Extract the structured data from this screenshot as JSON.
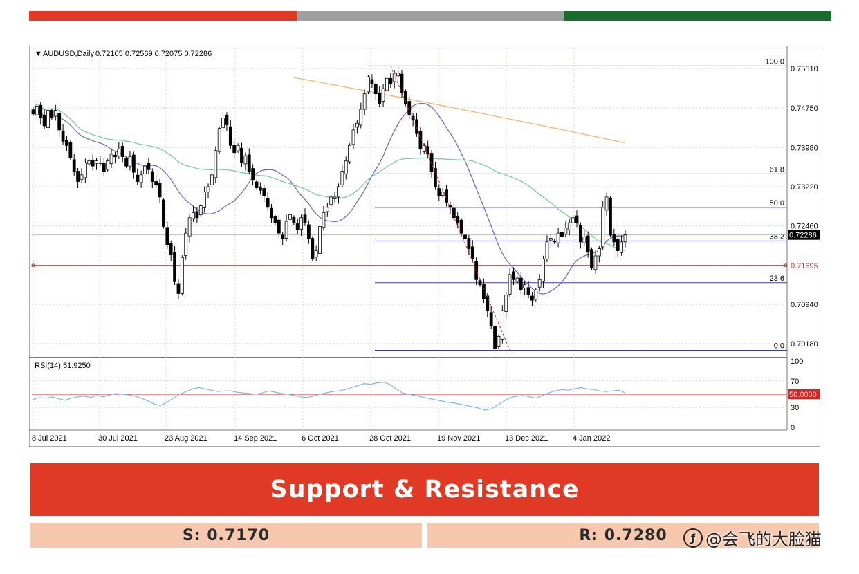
{
  "colors": {
    "red": "#e03a26",
    "gray": "#a0a0a0",
    "green": "#1a6b2e",
    "salmon": "#f6c9ae",
    "grid": "#d4d4d4",
    "bull": "#ffffff",
    "bear": "#000000"
  },
  "chart_header": {
    "symbol": "AUDUSD,Daily",
    "ohlc": "0.72105 0.72569 0.72075 0.72286"
  },
  "rsi_header": {
    "label": "RSI(14) 51.9250"
  },
  "price_axis": {
    "ticks": [
      "0.75510",
      "0.74750",
      "0.73980",
      "0.73220",
      "0.72460",
      "0.70940",
      "0.70180"
    ],
    "current_label": "0.72286",
    "support_label": "0.71695"
  },
  "rsi_axis": {
    "ticks": [
      "100",
      "70",
      "50.0000",
      "30",
      "0"
    ]
  },
  "time_axis": {
    "labels": [
      "8 Jul 2021",
      "30 Jul 2021",
      "23 Aug 2021",
      "14 Sep 2021",
      "6 Oct 2021",
      "28 Oct 2021",
      "19 Nov 2021",
      "13 Dec 2021",
      "4 Jan 2022"
    ]
  },
  "fib_levels": [
    {
      "label": "100.0",
      "price": 0.7556
    },
    {
      "label": "61.8",
      "price": 0.7347
    },
    {
      "label": "50.0",
      "price": 0.7282
    },
    {
      "label": "38.2",
      "price": 0.7217
    },
    {
      "label": "23.6",
      "price": 0.7136
    },
    {
      "label": "0.0",
      "price": 0.7005
    }
  ],
  "chart_data": {
    "type": "line",
    "title": "AUDUSD,Daily",
    "ylim": [
      0.6995,
      0.759
    ],
    "support_line": 0.71695,
    "current_price": 0.72286,
    "closes": [
      0.7463,
      0.7478,
      0.7455,
      0.744,
      0.747,
      0.7455,
      0.747,
      0.7432,
      0.741,
      0.7402,
      0.7378,
      0.7352,
      0.7332,
      0.7345,
      0.7368,
      0.7372,
      0.7362,
      0.7372,
      0.7368,
      0.7352,
      0.7372,
      0.7385,
      0.738,
      0.7395,
      0.738,
      0.7362,
      0.738,
      0.735,
      0.7332,
      0.7345,
      0.7362,
      0.7355,
      0.7332,
      0.7325,
      0.7302,
      0.7245,
      0.721,
      0.719,
      0.7138,
      0.7115,
      0.7185,
      0.7232,
      0.7262,
      0.7272,
      0.7262,
      0.7285,
      0.7312,
      0.7322,
      0.7345,
      0.7392,
      0.7435,
      0.7455,
      0.7442,
      0.7402,
      0.7388,
      0.7402,
      0.7368,
      0.7382,
      0.7352,
      0.7335,
      0.732,
      0.7315,
      0.7305,
      0.7282,
      0.7262,
      0.7252,
      0.7232,
      0.7222,
      0.7255,
      0.7268,
      0.7252,
      0.7238,
      0.7262,
      0.7252,
      0.7222,
      0.7182,
      0.7198,
      0.7245,
      0.7272,
      0.7282,
      0.7302,
      0.7302,
      0.7322,
      0.7352,
      0.7372,
      0.7402,
      0.7432,
      0.7445,
      0.7472,
      0.7502,
      0.7535,
      0.7522,
      0.7502,
      0.7482,
      0.7512,
      0.7532,
      0.7522,
      0.7542,
      0.7542,
      0.7505,
      0.7482,
      0.7462,
      0.7452,
      0.7425,
      0.7395,
      0.7402,
      0.7385,
      0.7352,
      0.7322,
      0.7305,
      0.7312,
      0.7292,
      0.7282,
      0.7262,
      0.7252,
      0.7232,
      0.7222,
      0.7202,
      0.7182,
      0.7142,
      0.7132,
      0.7105,
      0.7082,
      0.7052,
      0.7008,
      0.7032,
      0.7082,
      0.7112,
      0.7152,
      0.7142,
      0.7145,
      0.7122,
      0.7132,
      0.7112,
      0.7102,
      0.7122,
      0.7142,
      0.7182,
      0.7215,
      0.7222,
      0.7215,
      0.7232,
      0.7225,
      0.7242,
      0.7252,
      0.7262,
      0.7252,
      0.7215,
      0.7225,
      0.7195,
      0.7165,
      0.7188,
      0.7202,
      0.7282,
      0.7302,
      0.7228,
      0.7215,
      0.7198,
      0.7215,
      0.7229
    ],
    "rsi_values": [
      42,
      45,
      44,
      46,
      43,
      41,
      44,
      46,
      47,
      45,
      48,
      46,
      49,
      51,
      50,
      49,
      47,
      44,
      40,
      35,
      33,
      38,
      44,
      50,
      54,
      58,
      60,
      58,
      56,
      54,
      55,
      55,
      53,
      52,
      51,
      50,
      52,
      55,
      53,
      51,
      50,
      48,
      46,
      45,
      47,
      50,
      52,
      54,
      55,
      57,
      60,
      63,
      66,
      65,
      67,
      68,
      65,
      58,
      52,
      50,
      48,
      46,
      44,
      42,
      40,
      38,
      37,
      35,
      33,
      31,
      29,
      26,
      28,
      34,
      40,
      45,
      47,
      48,
      46,
      44,
      48,
      52,
      55,
      57,
      56,
      58,
      60,
      58,
      57,
      55,
      54,
      55,
      56,
      52
    ],
    "ma_fast": {
      "color": "#6f6fbf"
    },
    "ma_mid": {
      "color": "#7ccba4"
    },
    "ma_slow": {
      "color": "#f5b56b"
    }
  },
  "panel": {
    "title": "Support & Resistance",
    "support": "S: 0.7170",
    "resistance": "R: 0.7280"
  },
  "watermark": {
    "text": "@会飞的大脸猫",
    "logo": "ƒ"
  }
}
